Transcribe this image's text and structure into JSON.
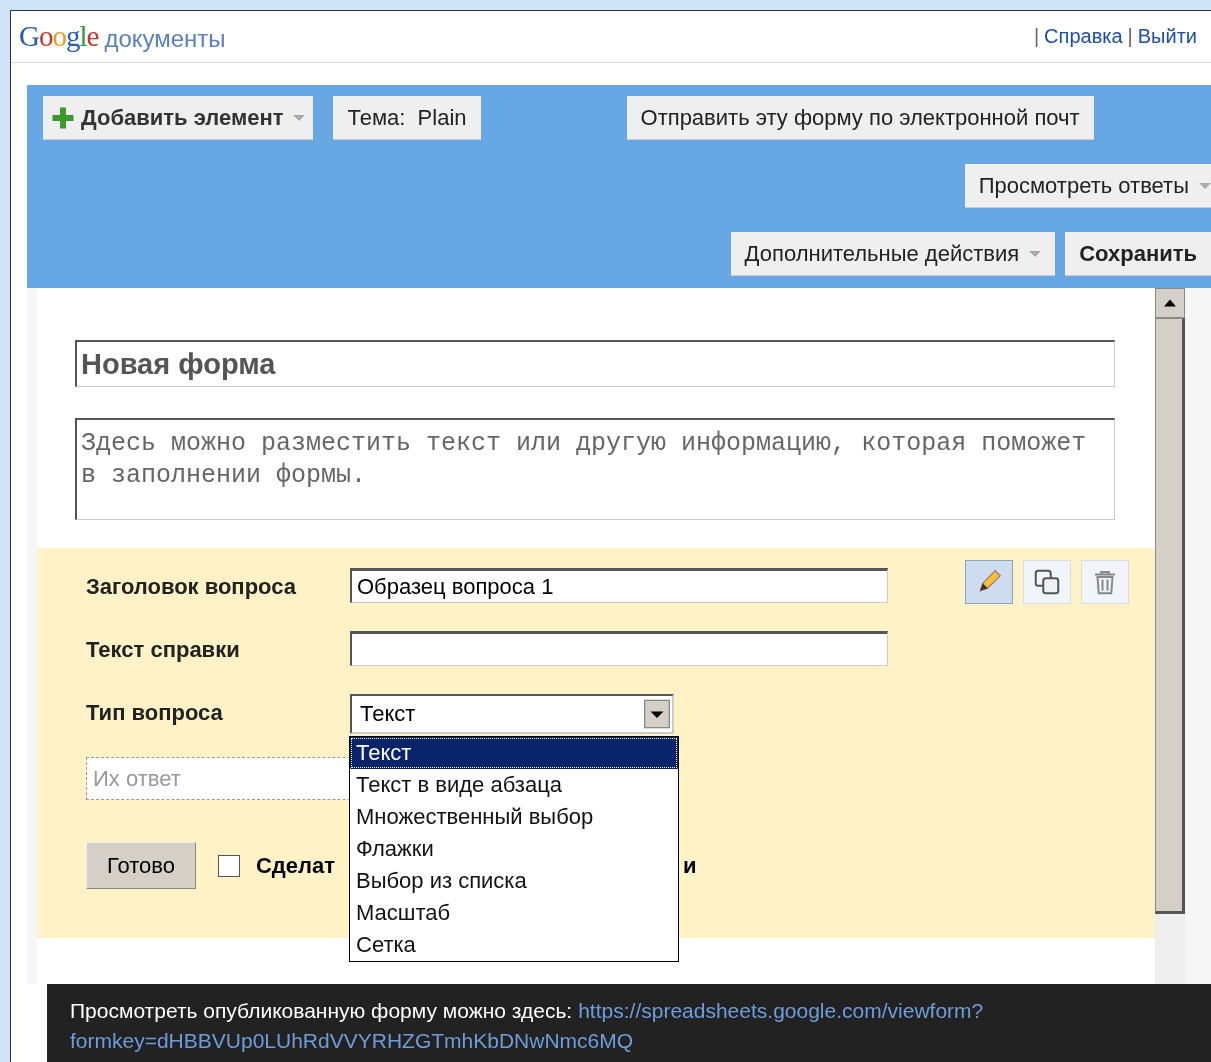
{
  "header": {
    "logo": "Google",
    "product": "документы",
    "separator": "|",
    "links": [
      "Справка",
      "Выйти"
    ]
  },
  "toolbar": {
    "add_element": "Добавить элемент",
    "theme_label": "Тема:",
    "theme_value": "Plain",
    "send": "Отправить эту форму по электронной почт",
    "view_responses": "Просмотреть ответы",
    "more_actions": "Дополнительные действия",
    "save": "Сохранить"
  },
  "form": {
    "title": "Новая форма",
    "description": "Здесь можно разместить текст или другую информацию, которая поможет в заполнении формы."
  },
  "question": {
    "fields": [
      {
        "label": "Заголовок вопроса",
        "value": "Образец вопроса 1"
      },
      {
        "label": "Текст справки"
      }
    ],
    "type_label": "Тип вопроса",
    "type_value": "Текст",
    "tools": [
      {
        "kind": "edit",
        "selected": true
      },
      {
        "kind": "copy",
        "selected": false
      },
      {
        "kind": "delete",
        "selected": false
      }
    ],
    "type_options": [
      {
        "label": "Текст",
        "selected": true
      },
      {
        "label": "Текст в виде абзаца",
        "selected": false
      },
      {
        "label": "Множественный выбор",
        "selected": false
      },
      {
        "label": "Флажки",
        "selected": false
      },
      {
        "label": "Выбор из списка",
        "selected": false
      },
      {
        "label": "Масштаб",
        "selected": false
      },
      {
        "label": "Сетка",
        "selected": false
      }
    ],
    "answer_placeholder": "Их ответ",
    "done": "Готово",
    "required_checked": false,
    "required_label_start": "Сделат",
    "required_label_end": "и"
  },
  "footer": {
    "text": "Просмотреть опубликованную форму можно здесь:",
    "link_lines": [
      "https://spreadsheets.google.com/viewform?",
      "formkey=dHBBVUp0LUhRdVVYRHZGTmhKbDNwNmc6MQ"
    ]
  }
}
